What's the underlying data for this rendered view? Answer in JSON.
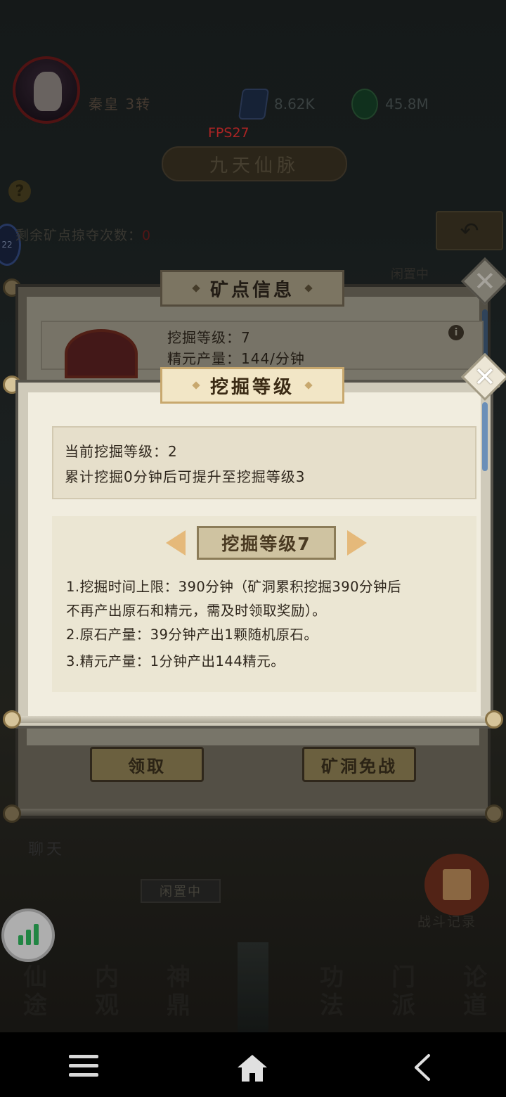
{
  "hud": {
    "player_name": "秦皇 3转",
    "resource_1": "8.62K",
    "resource_2": "45.8M",
    "fps": "FPS27",
    "map_title": "九天仙脉",
    "remain_label": "剩余矿点掠夺次数：",
    "remain_value": "0",
    "badge": "22",
    "idle_status": "闲置中"
  },
  "mine_info_panel": {
    "title": "矿点信息",
    "dig_level": "挖掘等级：7",
    "essence_output": "精元产量：144/分钟",
    "collect_button": "领取",
    "exempt_button": "矿洞免战"
  },
  "dig_level_panel": {
    "title": "挖掘等级",
    "current_level": "当前挖掘等级：2",
    "progress_hint": "累计挖掘0分钟后可提升至挖掘等级3",
    "selected_tab": "挖掘等级7",
    "desc_1": "1.挖掘时间上限：390分钟（矿洞累积挖掘390分钟后",
    "desc_1b": "不再产出原石和精元，需及时领取奖励）。",
    "desc_2": "2.原石产量：39分钟产出1颗随机原石。",
    "desc_3": "3.精元产量：1分钟产出144精元。"
  },
  "bottom": {
    "chat": "聊天",
    "idle": "闲置中",
    "battle_record": "战斗记录",
    "nav": [
      {
        "t": "仙",
        "b": "途"
      },
      {
        "t": "内",
        "b": "观"
      },
      {
        "t": "神",
        "b": "鼎"
      },
      {
        "t": "功",
        "b": "法"
      },
      {
        "t": "门",
        "b": "派"
      },
      {
        "t": "论",
        "b": "道"
      }
    ]
  },
  "icons": {
    "close": "close-icon",
    "back": "back-arrow-icon",
    "help": "help-icon",
    "info": "info-icon",
    "stats": "bar-chart-icon",
    "prev": "chevron-left-icon",
    "next": "chevron-right-icon"
  },
  "colors": {
    "accent_red": "#e23030",
    "arrow": "#e5b97a",
    "sheet": "#f1eddf"
  }
}
